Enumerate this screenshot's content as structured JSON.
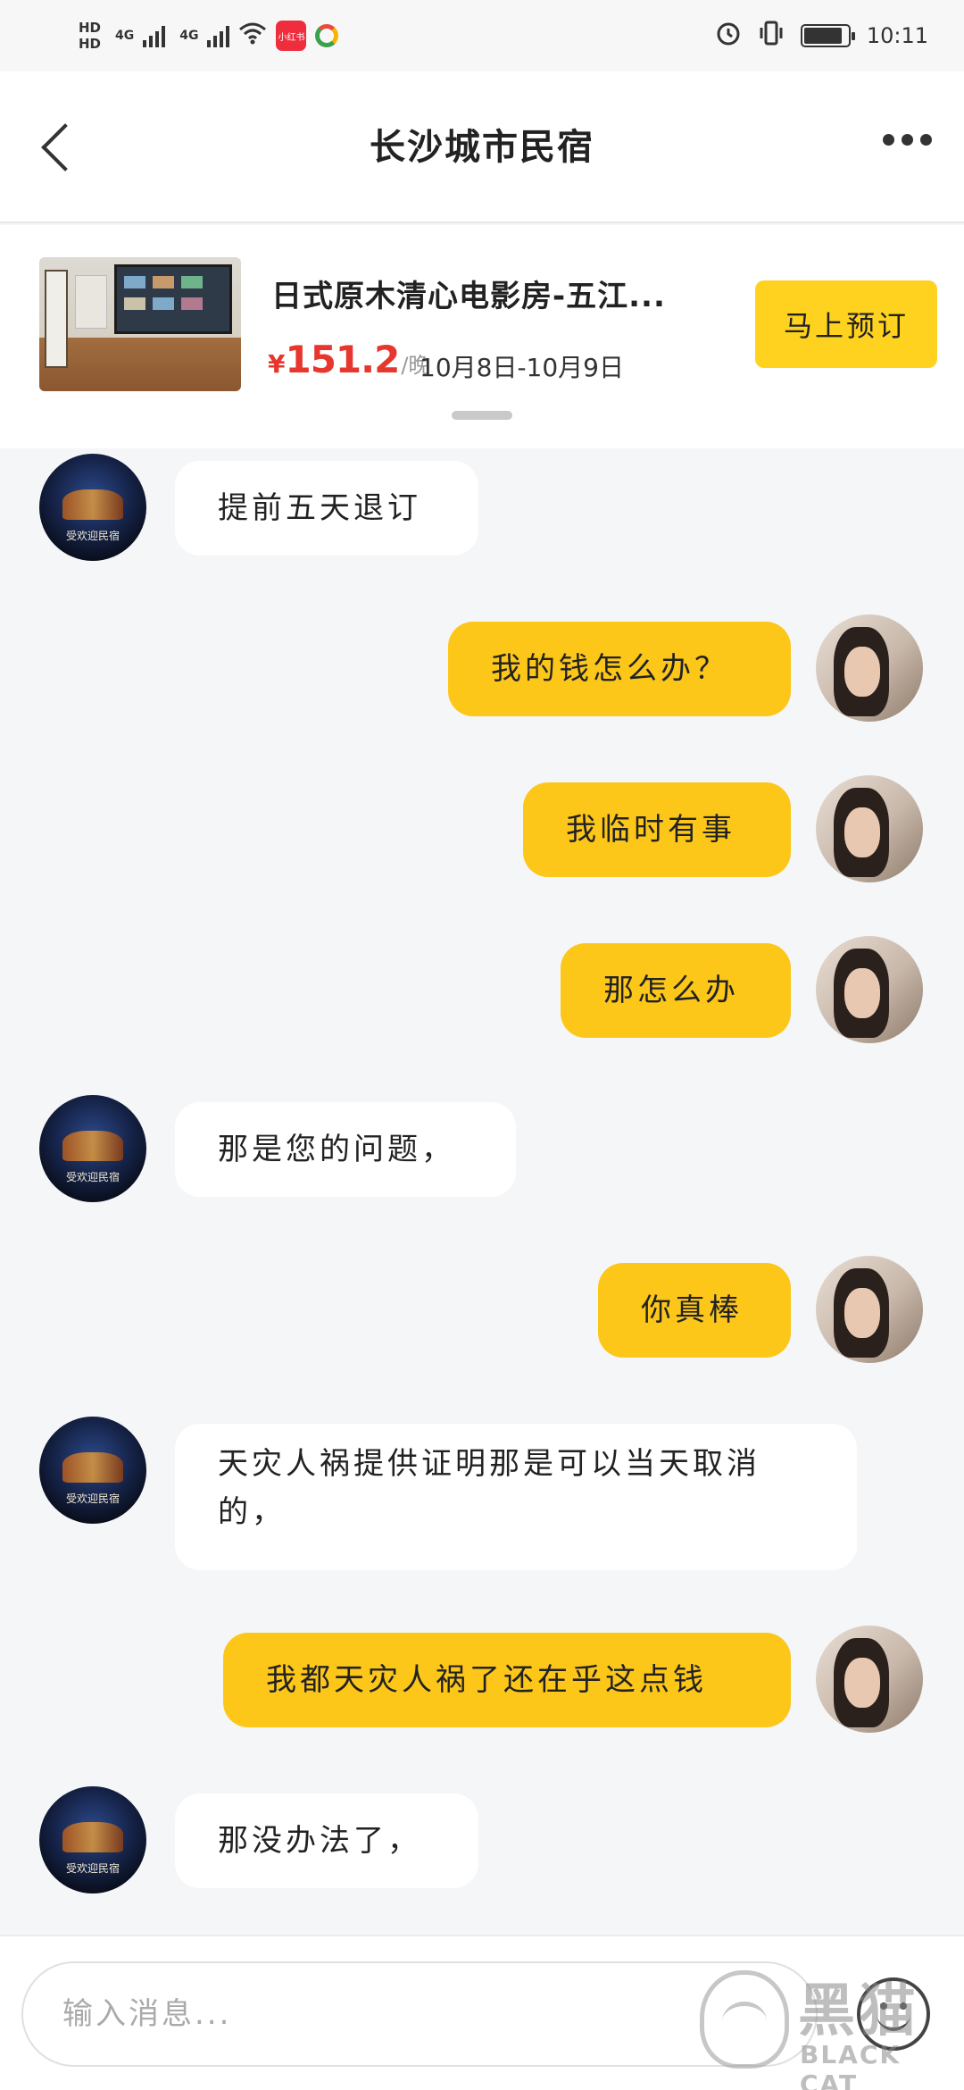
{
  "status_bar": {
    "hd1": "HD",
    "hd2": "HD",
    "net1": "4G",
    "net2": "4G",
    "app_badge": "小红书",
    "time": "10:11"
  },
  "header": {
    "title": "长沙城市民宿"
  },
  "listing": {
    "title": "日式原木清心电影房-五江...",
    "price_currency": "¥",
    "price": "151.2",
    "price_unit": "/晚",
    "dates": "10月8日-10月9日",
    "book_label": "马上预订"
  },
  "host": {
    "avatar_caption": "受欢迎民宿"
  },
  "messages": [
    {
      "from": "host",
      "text": "提前五天退订"
    },
    {
      "from": "user",
      "text": "我的钱怎么办？"
    },
    {
      "from": "user",
      "text": "我临时有事"
    },
    {
      "from": "user",
      "text": "那怎么办"
    },
    {
      "from": "host",
      "text": "那是您的问题，"
    },
    {
      "from": "user",
      "text": "你真棒"
    },
    {
      "from": "host",
      "text": "天灾人祸提供证明那是可以当天取消的，"
    },
    {
      "from": "user",
      "text": "我都天灾人祸了还在乎这点钱"
    },
    {
      "from": "host",
      "text": "那没办法了，"
    }
  ],
  "input": {
    "placeholder": "输入消息..."
  },
  "watermark": {
    "cn": "黑猫",
    "en": "BLACK CAT"
  }
}
